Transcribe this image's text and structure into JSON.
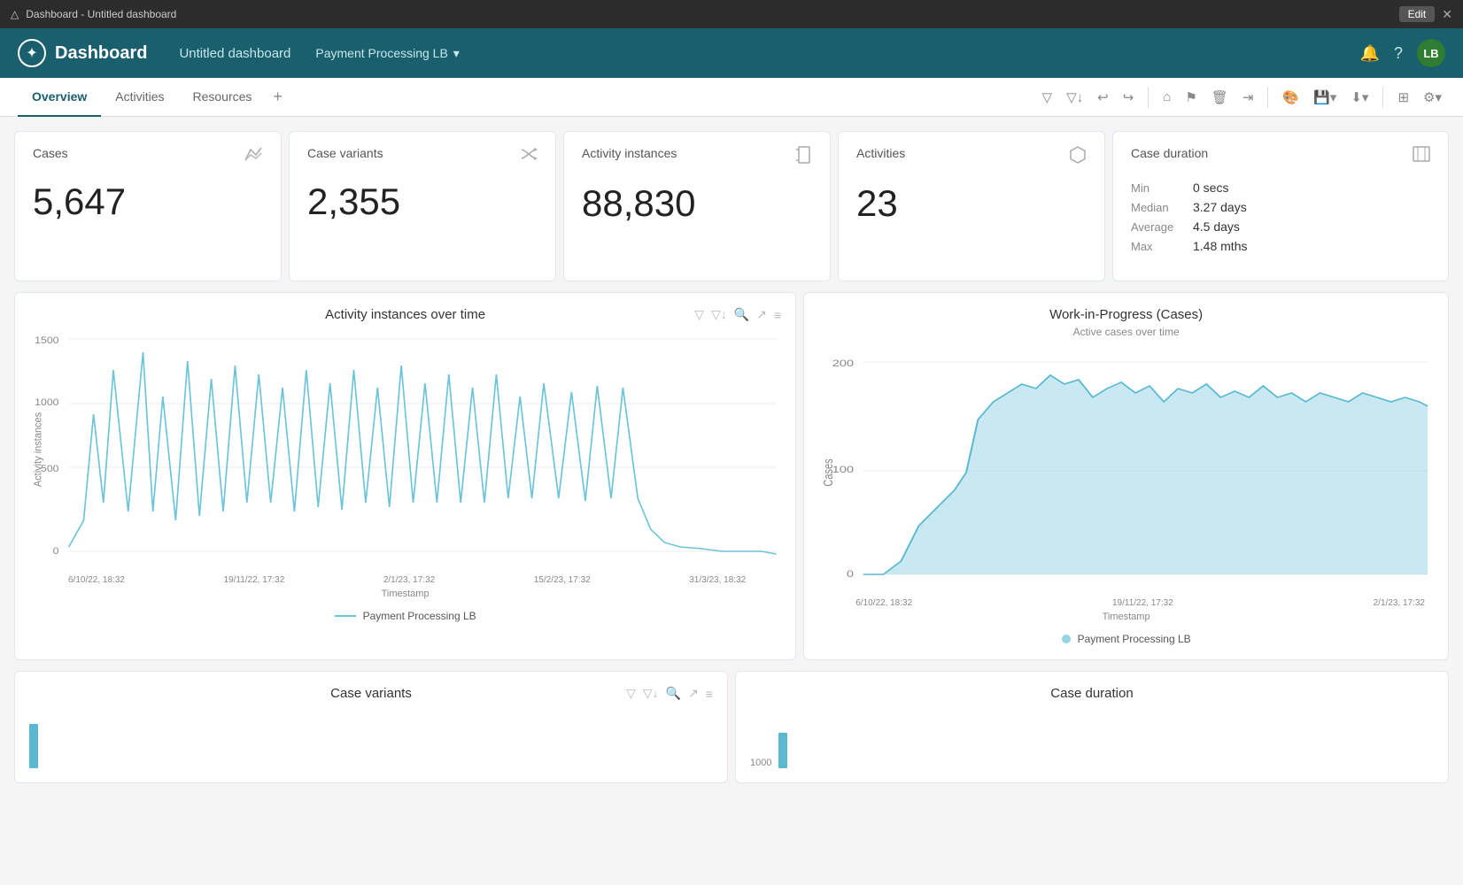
{
  "titleBar": {
    "icon": "⊞",
    "title": "Dashboard - Untitled dashboard",
    "editLabel": "Edit",
    "closeLabel": "✕",
    "alertIcon": "△"
  },
  "header": {
    "logoIcon": "✦",
    "appName": "Dashboard",
    "dashboardName": "Untitled dashboard",
    "filterName": "Payment Processing LB",
    "filterIcon": "▾",
    "bellIcon": "🔔",
    "helpIcon": "?",
    "avatar": "LB"
  },
  "nav": {
    "tabs": [
      {
        "id": "overview",
        "label": "Overview",
        "active": true
      },
      {
        "id": "activities",
        "label": "Activities"
      },
      {
        "id": "resources",
        "label": "Resources"
      }
    ],
    "addIcon": "+",
    "toolbar": {
      "filter": "▽",
      "filterDown": "▽↓",
      "undo": "↩",
      "redo": "↪",
      "home": "⌂",
      "bookmark": "⚑",
      "trash": "🗑",
      "share": "⇥",
      "palette": "🎨",
      "save": "💾",
      "download": "⬇",
      "grid": "⊞",
      "settings": "⚙"
    }
  },
  "kpi": {
    "cards": [
      {
        "id": "cases",
        "label": "Cases",
        "icon": "/|\\",
        "value": "5,647"
      },
      {
        "id": "case-variants",
        "label": "Case variants",
        "icon": "⇄",
        "value": "2,355"
      },
      {
        "id": "activity-instances",
        "label": "Activity instances",
        "icon": "⚑",
        "value": "88,830"
      },
      {
        "id": "activities",
        "label": "Activities",
        "icon": "⬡",
        "value": "23"
      }
    ],
    "durationCard": {
      "id": "case-duration",
      "label": "Case duration",
      "icon": "⊠",
      "rows": [
        {
          "label": "Min",
          "value": "0 secs"
        },
        {
          "label": "Median",
          "value": "3.27 days"
        },
        {
          "label": "Average",
          "value": "4.5 days"
        },
        {
          "label": "Max",
          "value": "1.48 mths"
        }
      ]
    }
  },
  "charts": {
    "activityInstances": {
      "title": "Activity instances over time",
      "xLabel": "Timestamp",
      "yLabel": "Activity instances",
      "legend": "Payment Processing LB",
      "xTicks": [
        "6/10/22, 18:32",
        "19/11/22, 17:32",
        "2/1/23, 17:32",
        "15/2/23, 17:32",
        "31/3/23, 18:32"
      ],
      "yTicks": [
        "0",
        "500",
        "1000",
        "1500"
      ]
    },
    "workInProgress": {
      "title": "Work-in-Progress (Cases)",
      "subtitle": "Active cases over time",
      "xLabel": "Timestamp",
      "yLabel": "Cases",
      "legend": "Payment Processing LB",
      "xTicks": [
        "6/10/22, 18:32",
        "19/11/22, 17:32",
        "2/1/23, 17:32"
      ],
      "yTicks": [
        "0",
        "100",
        "200"
      ]
    }
  },
  "bottomCharts": {
    "caseVariants": {
      "title": "Case variants"
    },
    "caseDuration": {
      "title": "Case duration",
      "yLabel": "1000"
    }
  }
}
